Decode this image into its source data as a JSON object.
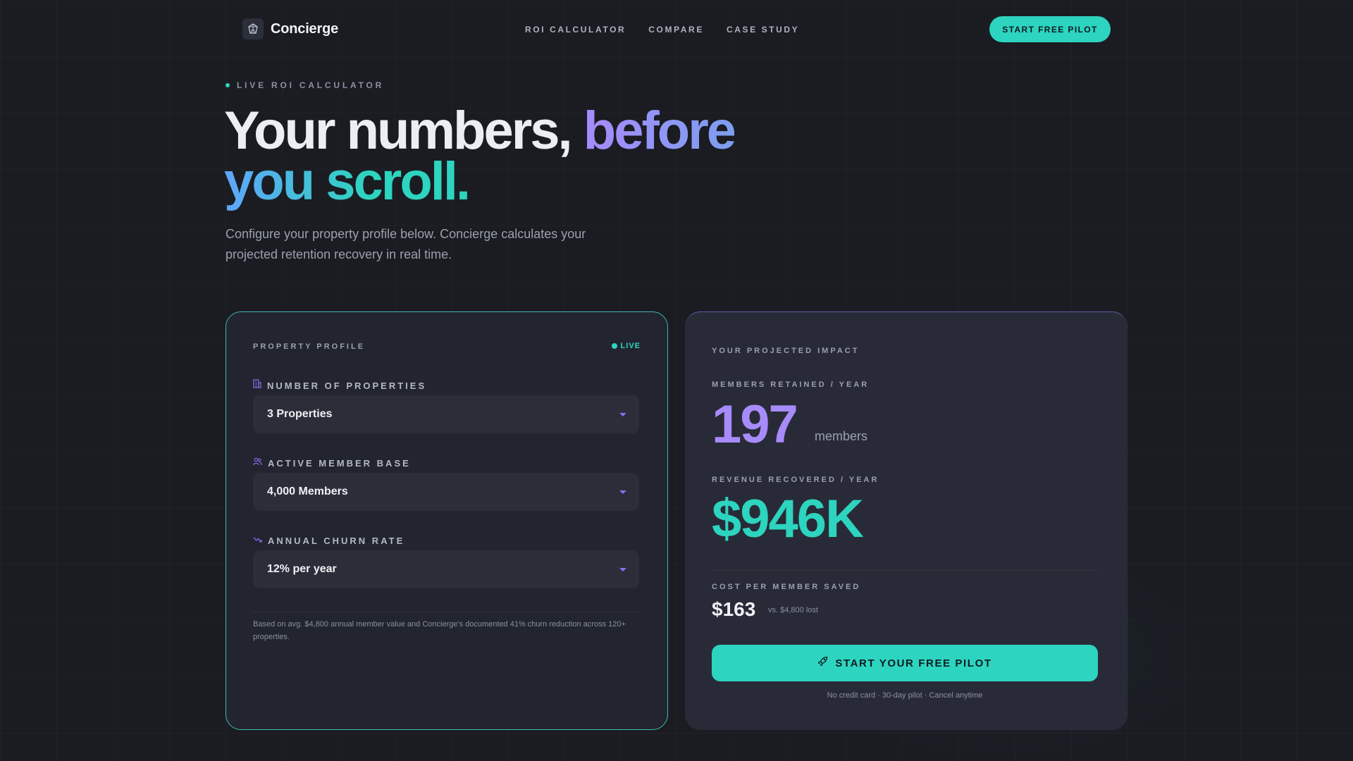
{
  "brand": {
    "name": "Concierge"
  },
  "nav": {
    "links": [
      "ROI CALCULATOR",
      "COMPARE",
      "CASE STUDY"
    ],
    "cta": "START FREE PILOT"
  },
  "hero": {
    "eyebrow": "LIVE ROI CALCULATOR",
    "headline_part1": "Your numbers, ",
    "headline_part2": "before",
    "headline_part3": "you scroll.",
    "subcopy": "Configure your property profile below. Concierge calculates your projected retention recovery in real time."
  },
  "profile": {
    "title": "PROPERTY PROFILE",
    "live": "LIVE",
    "fields": [
      {
        "label": "NUMBER OF PROPERTIES",
        "value": "3 Properties",
        "icon": "building-icon"
      },
      {
        "label": "ACTIVE MEMBER BASE",
        "value": "4,000 Members",
        "icon": "users-icon"
      },
      {
        "label": "ANNUAL CHURN RATE",
        "value": "12% per year",
        "icon": "trending-down-icon"
      }
    ],
    "footnote": "Based on avg. $4,800 annual member value and Concierge's documented 41% churn reduction across 120+ properties."
  },
  "impact": {
    "title": "YOUR PROJECTED IMPACT",
    "members_label": "MEMBERS RETAINED / YEAR",
    "members_value": "197",
    "members_unit": "members",
    "revenue_label": "REVENUE RECOVERED / YEAR",
    "revenue_value": "$946K",
    "cost_label": "COST PER MEMBER SAVED",
    "cost_value": "$163",
    "cost_vs": "vs. $4,800 lost",
    "cta": "START YOUR FREE PILOT",
    "cta_note": "No credit card · 30-day pilot · Cancel anytime"
  },
  "colors": {
    "accent_teal": "#2dd4bf",
    "accent_purple": "#a78bfa",
    "background": "#1a1c22"
  }
}
